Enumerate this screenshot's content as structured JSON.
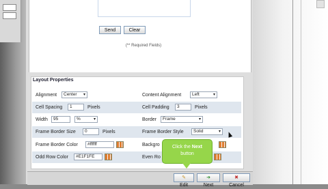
{
  "form": {
    "send_label": "Send",
    "clear_label": "Clear",
    "required_note": "(** Required Fields)"
  },
  "layout": {
    "title": "Layout Properties",
    "alignment_label": "Alignment",
    "alignment_value": "Center",
    "content_alignment_label": "Content Alignment",
    "content_alignment_value": "Left",
    "cell_spacing_label": "Cell Spacing",
    "cell_spacing_value": "1",
    "cell_spacing_unit": "Pixels",
    "cell_padding_label": "Cell Padding",
    "cell_padding_value": "3",
    "cell_padding_unit": "Pixels",
    "width_label": "Width",
    "width_value": "95",
    "width_unit_value": "%",
    "border_label": "Border",
    "border_value": "Frame",
    "frame_border_size_label": "Frame Border Size",
    "frame_border_size_value": "0",
    "frame_border_size_unit": "Pixels",
    "frame_border_style_label": "Frame Border Style",
    "frame_border_style_value": "Solid",
    "frame_border_color_label": "Frame Border Color",
    "frame_border_color_value": "#ffffff",
    "background_label": "Backgro",
    "odd_row_color_label": "Odd Row Color",
    "odd_row_color_value": "#E1F1FE",
    "even_row_label": "Even Ro"
  },
  "tooltip": {
    "line1_prefix": "Click the ",
    "line1_bold": "Next",
    "line2": "button"
  },
  "bottom": {
    "edit_label": "Edit",
    "next_label": "Next",
    "cancel_label": "Cancel"
  },
  "colors": {
    "tooltip_bg": "#96d64a",
    "row_alt": "#dfe6ee"
  }
}
